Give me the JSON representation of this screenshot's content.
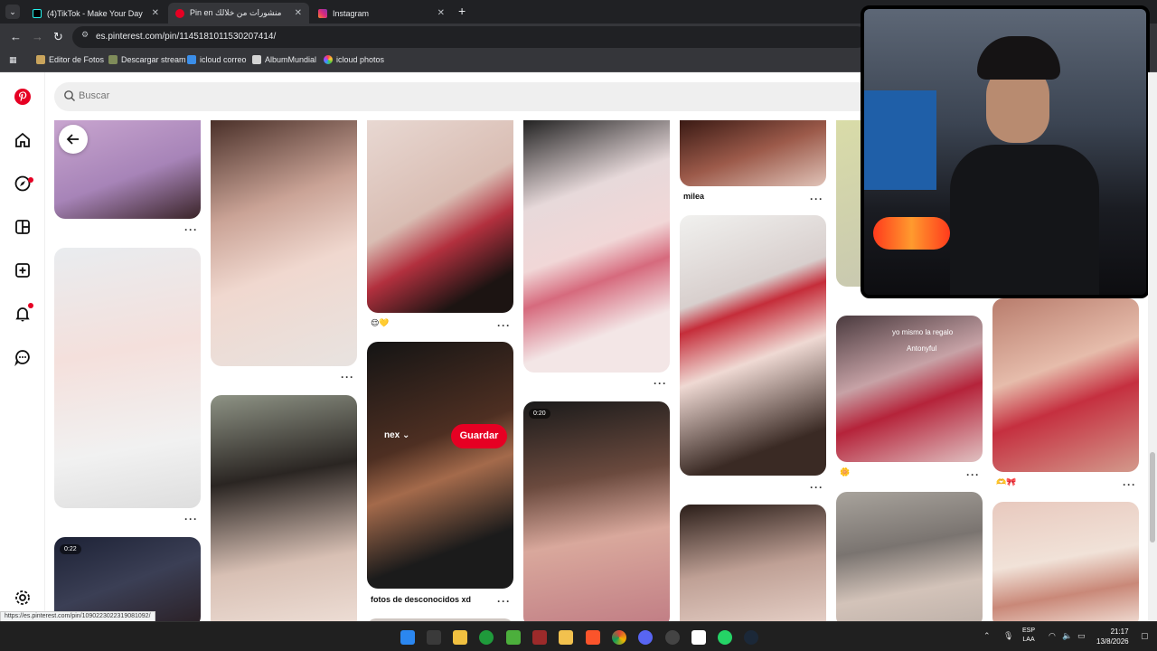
{
  "browser": {
    "tabs": [
      {
        "title": "(4)TikTok - Make Your Day",
        "active": false
      },
      {
        "title": "Pin en منشورات من خلالك",
        "active": true
      },
      {
        "title": "Instagram",
        "active": false
      }
    ],
    "url": "es.pinterest.com/pin/1145181011530207414/",
    "bookmarks": [
      "Editor de Fotos",
      "Descargar stream",
      "icloud correo",
      "AlbumMundial",
      "icloud photos"
    ]
  },
  "pinterest": {
    "search_placeholder": "Buscar",
    "save_label": "Guardar",
    "board_selector": "nex",
    "captions": {
      "milea": "milea",
      "fotos": "fotos de desconocidos xd",
      "emoji1": "😌💛",
      "emoji2": "🫶🎀",
      "emoji3": "🌼"
    },
    "video_durations": [
      "0:22",
      "0:20"
    ],
    "overlay_text": {
      "line1": "yo mismo la regalo",
      "line2": "Antonyful"
    }
  },
  "status_url": "https://es.pinterest.com/pin/1090223022319081092/",
  "taskbar": {
    "lang_top": "ESP",
    "lang_bottom": "LAA",
    "time": "21:17",
    "date": "13/8/2026"
  },
  "colors": {
    "pinterest_red": "#e60023",
    "chrome_dark": "#35363a"
  }
}
